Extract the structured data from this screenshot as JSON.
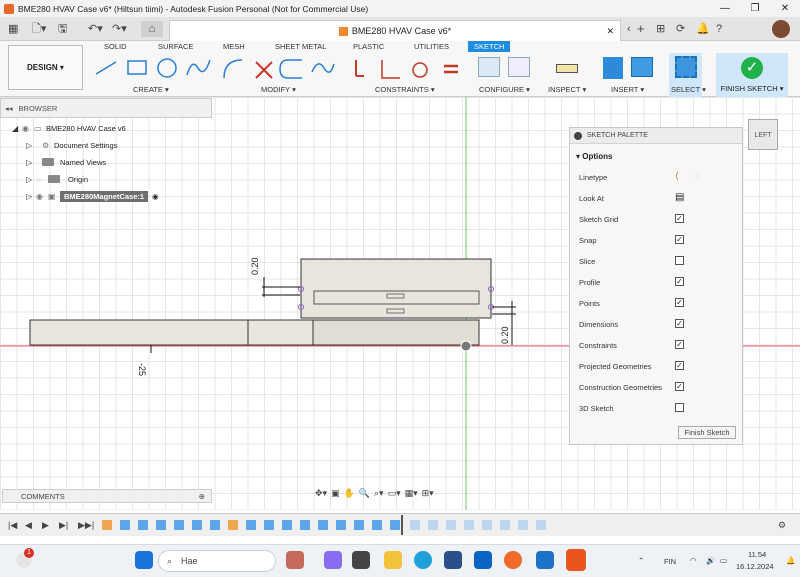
{
  "window": {
    "title": "BME280 HVAV Case v6* (Hiltsun tiimi) - Autodesk Fusion Personal (Not for Commercial Use)"
  },
  "document_tab": {
    "title": "BME280 HVAV Case v6*"
  },
  "workspace": {
    "label": "DESIGN"
  },
  "ribbon": {
    "tabs": [
      "SOLID",
      "SURFACE",
      "MESH",
      "SHEET METAL",
      "PLASTIC",
      "UTILITIES",
      "SKETCH"
    ],
    "groups": [
      "CREATE",
      "MODIFY",
      "CONSTRAINTS",
      "CONFIGURE",
      "INSPECT",
      "INSERT",
      "SELECT",
      "FINISH SKETCH"
    ],
    "finish_label": "FINISH SKETCH"
  },
  "browser": {
    "header": "BROWSER",
    "root": "BME280 HVAV Case v6",
    "items": [
      "Document Settings",
      "Named Views",
      "Origin",
      "BME280MagnetCase:1"
    ]
  },
  "palette": {
    "title": "SKETCH PALETTE",
    "section": "Options",
    "rows": [
      {
        "label": "Linetype",
        "checked": null
      },
      {
        "label": "Look At",
        "checked": null
      },
      {
        "label": "Sketch Grid",
        "checked": true
      },
      {
        "label": "Snap",
        "checked": true
      },
      {
        "label": "Slice",
        "checked": false
      },
      {
        "label": "Profile",
        "checked": true
      },
      {
        "label": "Points",
        "checked": true
      },
      {
        "label": "Dimensions",
        "checked": true
      },
      {
        "label": "Constraints",
        "checked": true
      },
      {
        "label": "Projected Geometries",
        "checked": true
      },
      {
        "label": "Construction Geometries",
        "checked": true
      },
      {
        "label": "3D Sketch",
        "checked": false
      }
    ],
    "finish_button": "Finish Sketch",
    "check_mark": "✓"
  },
  "viewcube": {
    "label": "LEFT"
  },
  "dimensions": {
    "top": "0.20",
    "right": "0.20",
    "bottom": "-25"
  },
  "comments": {
    "label": "COMMENTS"
  },
  "taskbar": {
    "search_placeholder": "Hae",
    "lang": "FIN",
    "time": "11.54",
    "date": "16.12.2024",
    "notif": "1"
  },
  "colors": {
    "accent": "#1c8de1",
    "finish_green": "#1fb14a",
    "body_fill": "#e8e5dc",
    "axis_green": "#6cc66c",
    "axis_red": "#e55b5b"
  }
}
